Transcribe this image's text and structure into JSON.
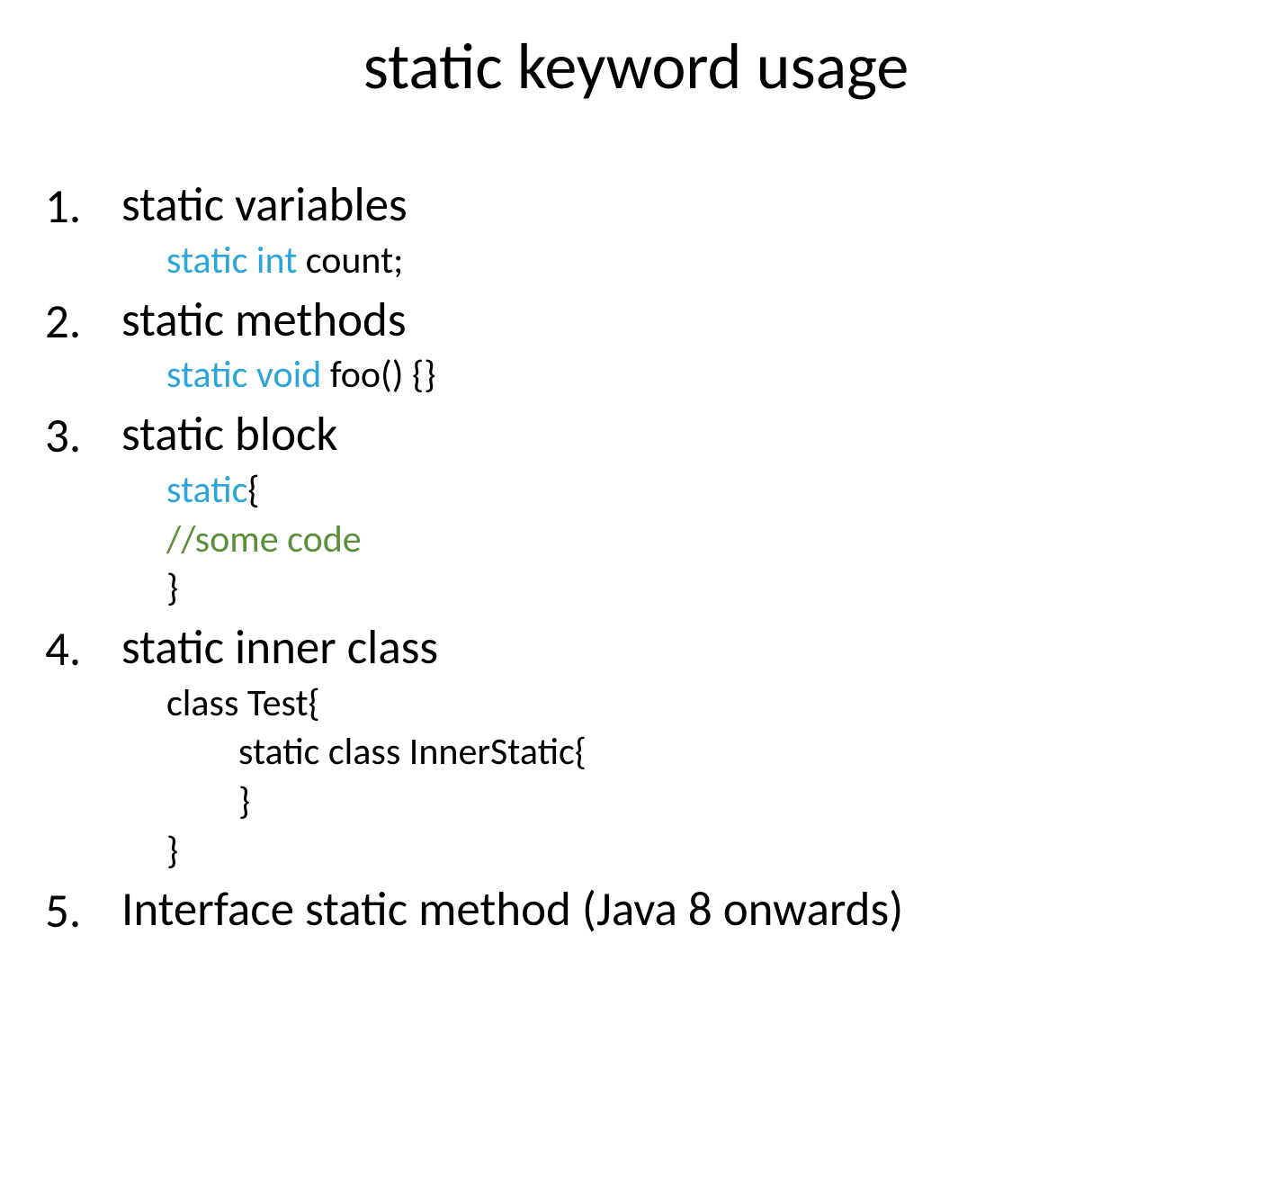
{
  "title": "static keyword usage",
  "items": [
    {
      "title": "static variables",
      "code": [
        {
          "segments": [
            {
              "text": "static int ",
              "class": "keyword"
            },
            {
              "text": "count;",
              "class": "normal"
            }
          ]
        }
      ]
    },
    {
      "title": "static methods",
      "code": [
        {
          "segments": [
            {
              "text": "static void ",
              "class": "keyword"
            },
            {
              "text": "foo() {}",
              "class": "normal"
            }
          ]
        }
      ]
    },
    {
      "title": "static block",
      "code": [
        {
          "segments": [
            {
              "text": "static",
              "class": "keyword"
            },
            {
              "text": "{",
              "class": "normal"
            }
          ]
        },
        {
          "segments": [
            {
              "text": "//some code",
              "class": "comment"
            }
          ]
        },
        {
          "segments": [
            {
              "text": "}",
              "class": "normal"
            }
          ]
        }
      ]
    },
    {
      "title": "static inner class",
      "code": [
        {
          "segments": [
            {
              "text": "class Test{",
              "class": "normal"
            }
          ]
        },
        {
          "indent": 1,
          "segments": [
            {
              "text": "static class InnerStatic{",
              "class": "normal"
            }
          ]
        },
        {
          "indent": 1,
          "segments": [
            {
              "text": "}",
              "class": "normal"
            }
          ]
        },
        {
          "segments": [
            {
              "text": "}",
              "class": "normal"
            }
          ]
        }
      ]
    },
    {
      "title": "Interface static method (Java 8 onwards)",
      "code": []
    }
  ]
}
